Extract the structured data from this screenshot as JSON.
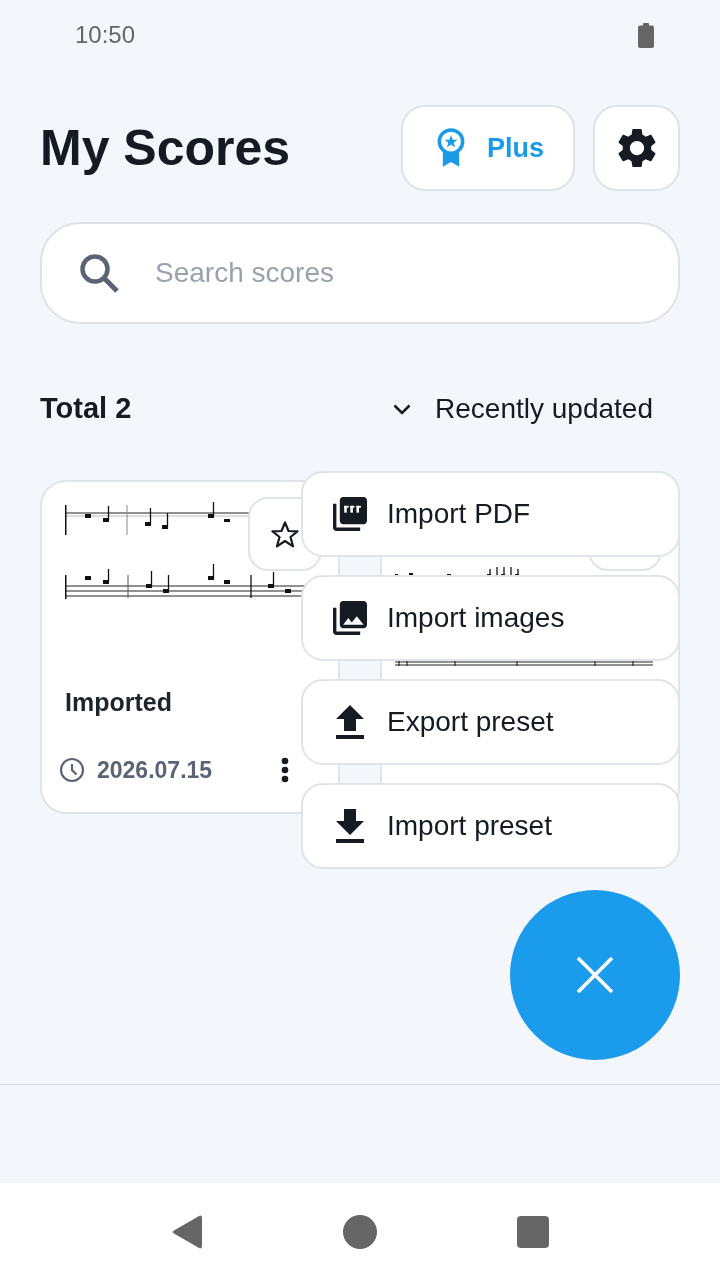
{
  "status_bar": {
    "time": "10:50"
  },
  "header": {
    "title": "My Scores",
    "plus_button": {
      "label": "Plus"
    }
  },
  "search": {
    "placeholder": "Search scores"
  },
  "list_header": {
    "total": "Total 2",
    "sort": "Recently updated"
  },
  "score_cards": [
    {
      "kind": "full",
      "title": "Imported",
      "date": "2026.07.15",
      "starred": false
    },
    {
      "kind": "covered"
    }
  ],
  "fab": {
    "expanded": true
  },
  "menu": {
    "items": [
      {
        "kind": "pdf",
        "label": "Import PDF"
      },
      {
        "kind": "images",
        "label": "Import images"
      },
      {
        "kind": "export",
        "label": "Export preset"
      },
      {
        "kind": "import",
        "label": "Import preset"
      }
    ]
  }
}
